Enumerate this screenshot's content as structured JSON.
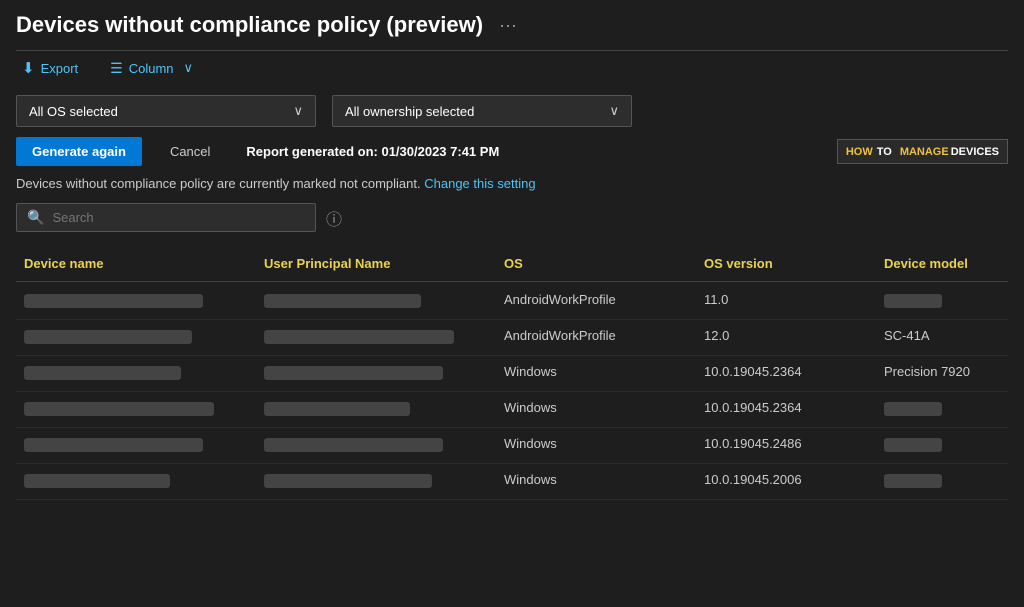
{
  "header": {
    "title": "Devices without compliance policy (preview)",
    "ellipsis": "···"
  },
  "toolbar": {
    "export_label": "Export",
    "column_label": "Column"
  },
  "filters": {
    "os_filter_label": "All OS selected",
    "ownership_filter_label": "All ownership selected"
  },
  "actions": {
    "generate_label": "Generate again",
    "cancel_label": "Cancel",
    "report_generated": "Report generated on: 01/30/2023 7:41 PM"
  },
  "logo": {
    "how": "HOW",
    "to": "TO",
    "manage": "MANAGE",
    "devices": "DEVICES"
  },
  "compliance_notice": {
    "text": "Devices without compliance policy are currently marked not compliant.",
    "link_text": "Change this setting"
  },
  "search": {
    "placeholder": "Search"
  },
  "table": {
    "columns": [
      "Device name",
      "User Principal Name",
      "OS",
      "OS version",
      "Device model"
    ],
    "rows": [
      {
        "device_name": "",
        "upn": "",
        "os": "AndroidWorkProfile",
        "os_version": "11.0",
        "device_model": ""
      },
      {
        "device_name": "",
        "upn": "",
        "os": "AndroidWorkProfile",
        "os_version": "12.0",
        "device_model": "SC-41A"
      },
      {
        "device_name": "",
        "upn": "",
        "os": "Windows",
        "os_version": "10.0.19045.2364",
        "device_model": "Precision 7920"
      },
      {
        "device_name": "",
        "upn": "",
        "os": "Windows",
        "os_version": "10.0.19045.2364",
        "device_model": ""
      },
      {
        "device_name": "",
        "upn": "",
        "os": "Windows",
        "os_version": "10.0.19045.2486",
        "device_model": ""
      },
      {
        "device_name": "",
        "upn": "",
        "os": "Windows",
        "os_version": "10.0.19045.2006",
        "device_model": ""
      }
    ]
  }
}
